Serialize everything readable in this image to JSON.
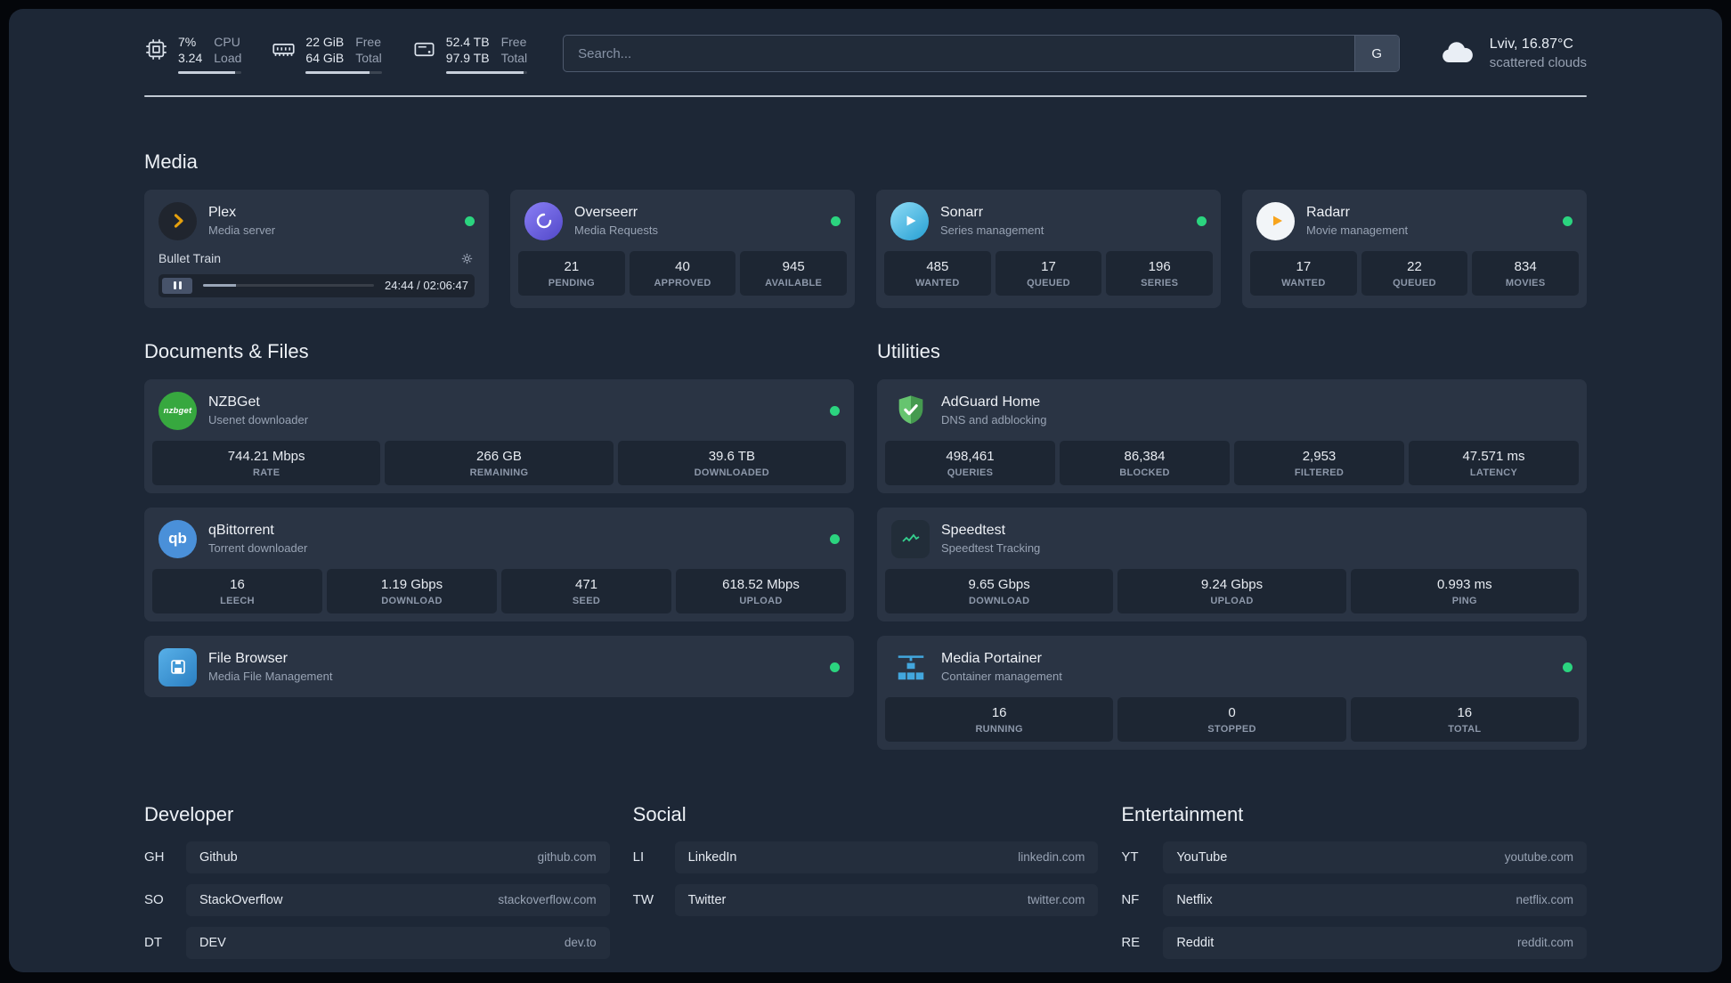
{
  "header": {
    "cpu": {
      "value1": "7%",
      "value2": "3.24",
      "label1": "CPU",
      "label2": "Load"
    },
    "memory": {
      "value1": "22 GiB",
      "value2": "64 GiB",
      "label1": "Free",
      "label2": "Total"
    },
    "disk": {
      "value1": "52.4 TB",
      "value2": "97.9 TB",
      "label1": "Free",
      "label2": "Total"
    },
    "search": {
      "placeholder": "Search...",
      "button_label": "G"
    },
    "weather": {
      "location": "Lviv, 16.87°C",
      "condition": "scattered clouds"
    }
  },
  "media": {
    "title": "Media",
    "plex": {
      "name": "Plex",
      "desc": "Media server",
      "now_playing": "Bullet Train",
      "time": "24:44 / 02:06:47"
    },
    "overseerr": {
      "name": "Overseerr",
      "desc": "Media Requests",
      "stats": [
        {
          "value": "21",
          "label": "PENDING"
        },
        {
          "value": "40",
          "label": "APPROVED"
        },
        {
          "value": "945",
          "label": "AVAILABLE"
        }
      ]
    },
    "sonarr": {
      "name": "Sonarr",
      "desc": "Series management",
      "stats": [
        {
          "value": "485",
          "label": "WANTED"
        },
        {
          "value": "17",
          "label": "QUEUED"
        },
        {
          "value": "196",
          "label": "SERIES"
        }
      ]
    },
    "radarr": {
      "name": "Radarr",
      "desc": "Movie management",
      "stats": [
        {
          "value": "17",
          "label": "WANTED"
        },
        {
          "value": "22",
          "label": "QUEUED"
        },
        {
          "value": "834",
          "label": "MOVIES"
        }
      ]
    }
  },
  "documents": {
    "title": "Documents & Files",
    "nzbget": {
      "name": "NZBGet",
      "desc": "Usenet downloader",
      "icon_text": "nzbget",
      "stats": [
        {
          "value": "744.21 Mbps",
          "label": "RATE"
        },
        {
          "value": "266 GB",
          "label": "REMAINING"
        },
        {
          "value": "39.6 TB",
          "label": "DOWNLOADED"
        }
      ]
    },
    "qbittorrent": {
      "name": "qBittorrent",
      "desc": "Torrent downloader",
      "icon_text": "qb",
      "stats": [
        {
          "value": "16",
          "label": "LEECH"
        },
        {
          "value": "1.19 Gbps",
          "label": "DOWNLOAD"
        },
        {
          "value": "471",
          "label": "SEED"
        },
        {
          "value": "618.52 Mbps",
          "label": "UPLOAD"
        }
      ]
    },
    "filebrowser": {
      "name": "File Browser",
      "desc": "Media File Management"
    }
  },
  "utilities": {
    "title": "Utilities",
    "adguard": {
      "name": "AdGuard Home",
      "desc": "DNS and adblocking",
      "stats": [
        {
          "value": "498,461",
          "label": "QUERIES"
        },
        {
          "value": "86,384",
          "label": "BLOCKED"
        },
        {
          "value": "2,953",
          "label": "FILTERED"
        },
        {
          "value": "47.571 ms",
          "label": "LATENCY"
        }
      ]
    },
    "speedtest": {
      "name": "Speedtest",
      "desc": "Speedtest Tracking",
      "stats": [
        {
          "value": "9.65 Gbps",
          "label": "DOWNLOAD"
        },
        {
          "value": "9.24 Gbps",
          "label": "UPLOAD"
        },
        {
          "value": "0.993 ms",
          "label": "PING"
        }
      ]
    },
    "portainer": {
      "name": "Media Portainer",
      "desc": "Container management",
      "stats": [
        {
          "value": "16",
          "label": "RUNNING"
        },
        {
          "value": "0",
          "label": "STOPPED"
        },
        {
          "value": "16",
          "label": "TOTAL"
        }
      ]
    }
  },
  "bookmarks": {
    "developer": {
      "title": "Developer",
      "items": [
        {
          "abbr": "GH",
          "name": "Github",
          "url": "github.com"
        },
        {
          "abbr": "SO",
          "name": "StackOverflow",
          "url": "stackoverflow.com"
        },
        {
          "abbr": "DT",
          "name": "DEV",
          "url": "dev.to"
        }
      ]
    },
    "social": {
      "title": "Social",
      "items": [
        {
          "abbr": "LI",
          "name": "LinkedIn",
          "url": "linkedin.com"
        },
        {
          "abbr": "TW",
          "name": "Twitter",
          "url": "twitter.com"
        }
      ]
    },
    "entertainment": {
      "title": "Entertainment",
      "items": [
        {
          "abbr": "YT",
          "name": "YouTube",
          "url": "youtube.com"
        },
        {
          "abbr": "NF",
          "name": "Netflix",
          "url": "netflix.com"
        },
        {
          "abbr": "RE",
          "name": "Reddit",
          "url": "reddit.com"
        }
      ]
    }
  }
}
